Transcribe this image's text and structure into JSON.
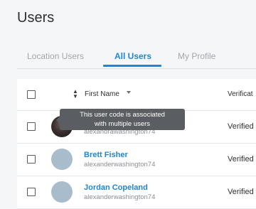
{
  "page": {
    "title": "Users"
  },
  "tabs": [
    {
      "label": "Location Users",
      "active": false
    },
    {
      "label": "All Users",
      "active": true
    },
    {
      "label": "My Profile",
      "active": false
    }
  ],
  "table": {
    "columns": {
      "first_name": "First Name",
      "verification": "Verificat"
    },
    "rows": [
      {
        "name": "",
        "username": "alexandrawashington74",
        "verification": "Verified",
        "avatar": "photo",
        "badge": "multi-user-badge"
      },
      {
        "name": "Brett Fisher",
        "username": "alexanderwashington74",
        "verification": "Verified",
        "avatar": "placeholder"
      },
      {
        "name": "Jordan Copeland",
        "username": "alexanderwashington74",
        "verification": "Verified",
        "avatar": "placeholder"
      }
    ]
  },
  "tooltip": {
    "line1": "This user code is associated",
    "line2": "with multiple users"
  },
  "colors": {
    "accent": "#1f86d6",
    "background": "#f4f6f8",
    "tooltip": "#5a5d61",
    "badge": "#e2363f"
  },
  "icons": [
    "sort-icon",
    "caret-down-icon",
    "warning-badge-icon"
  ]
}
